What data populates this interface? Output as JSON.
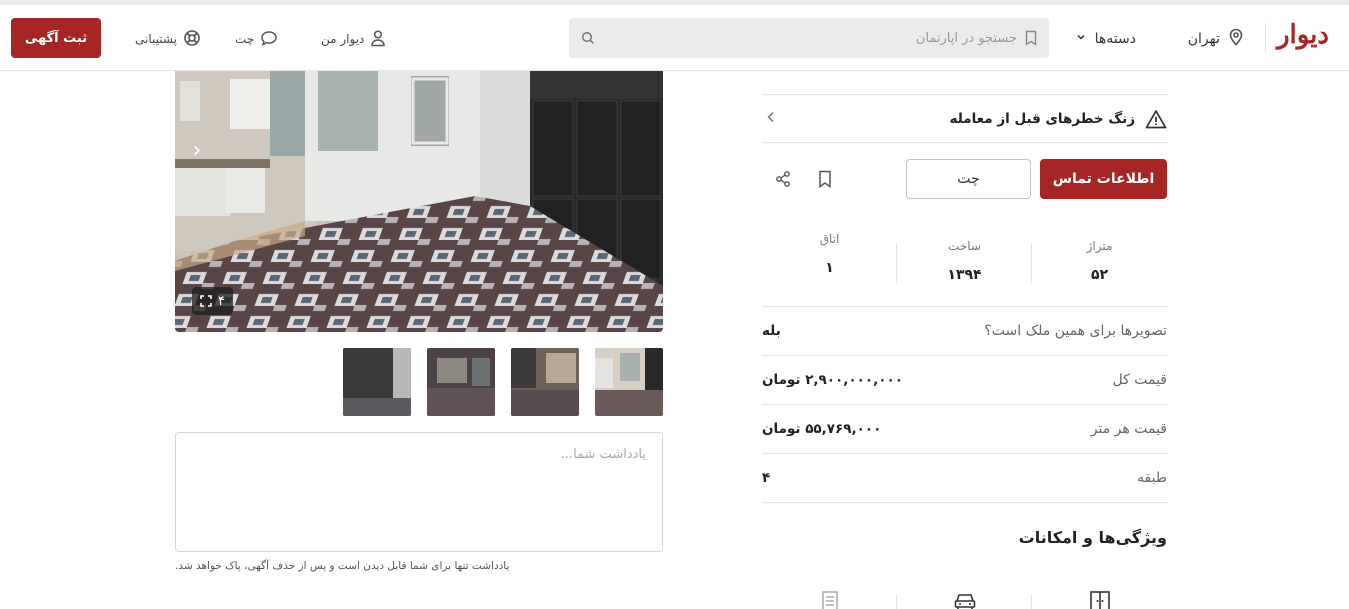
{
  "header": {
    "logo": "دیوار",
    "city": "تهران",
    "categories": "دسته‌ها",
    "search_placeholder": "جستجو در آپارتمان",
    "my_divar": "دیوار من",
    "chat": "چت",
    "support": "پشتیبانی",
    "post_ad": "ثبت آگهی"
  },
  "gallery": {
    "photo_count": "۴"
  },
  "note": {
    "placeholder": "یادداشت شما...",
    "hint": "یادداشت تنها برای شما قابل دیدن است و پس از حذف آگهی، پاک خواهد شد."
  },
  "panel": {
    "warning": "زنگ خطرهای قبل از معامله",
    "contact_button": "اطلاعات تماس",
    "chat_button": "چت",
    "stats": [
      {
        "label": "متراژ",
        "value": "۵۲"
      },
      {
        "label": "ساخت",
        "value": "۱۳۹۴"
      },
      {
        "label": "اتاق",
        "value": "۱"
      }
    ],
    "rows": [
      {
        "key": "تصویرها برای همین ملک است؟",
        "value": "بله"
      },
      {
        "key": "قیمت کل",
        "value": "۲,۹۰۰,۰۰۰,۰۰۰ تومان"
      },
      {
        "key": "قیمت هر متر",
        "value": "۵۵,۷۶۹,۰۰۰ تومان"
      },
      {
        "key": "طبقه",
        "value": "۴"
      }
    ],
    "features_title": "ویژگی‌ها و امکانات"
  },
  "colors": {
    "brand": "#a62626",
    "divider": "#e3e3e3"
  }
}
